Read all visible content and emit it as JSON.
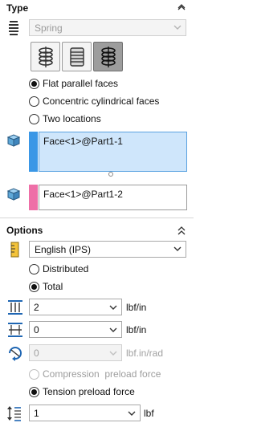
{
  "type_section": {
    "title": "Type",
    "type_select": {
      "value": "Spring"
    },
    "toggle_buttons": [
      "compression-spring",
      "extension-spring",
      "torsion-spring"
    ],
    "radios": [
      {
        "label": "Flat parallel faces",
        "checked": true
      },
      {
        "label": "Concentric cylindrical faces",
        "checked": false
      },
      {
        "label": "Two locations",
        "checked": false
      }
    ],
    "selection1": {
      "value": "Face<1>@Part1-1",
      "color": "#3a97e6"
    },
    "selection2": {
      "value": "Face<1>@Part1-2",
      "color": "#ee6fa7"
    }
  },
  "options_section": {
    "title": "Options",
    "units_select": {
      "value": "English (IPS)"
    },
    "radios": [
      {
        "label": "Distributed",
        "checked": false
      },
      {
        "label": "Total",
        "checked": true
      }
    ],
    "axial_stiffness": {
      "value": "2",
      "unit": "lbf/in"
    },
    "lateral_stiffness": {
      "value": "0",
      "unit": "lbf/in"
    },
    "rotational_stiffness": {
      "value": "0",
      "unit": "lbf.in/rad",
      "disabled": true
    },
    "preload_radios": [
      {
        "label": "Compression  preload force",
        "checked": false,
        "disabled": true
      },
      {
        "label": "Tension preload force",
        "checked": true,
        "disabled": false
      }
    ],
    "preload_force": {
      "value": "1",
      "unit": "lbf"
    }
  }
}
